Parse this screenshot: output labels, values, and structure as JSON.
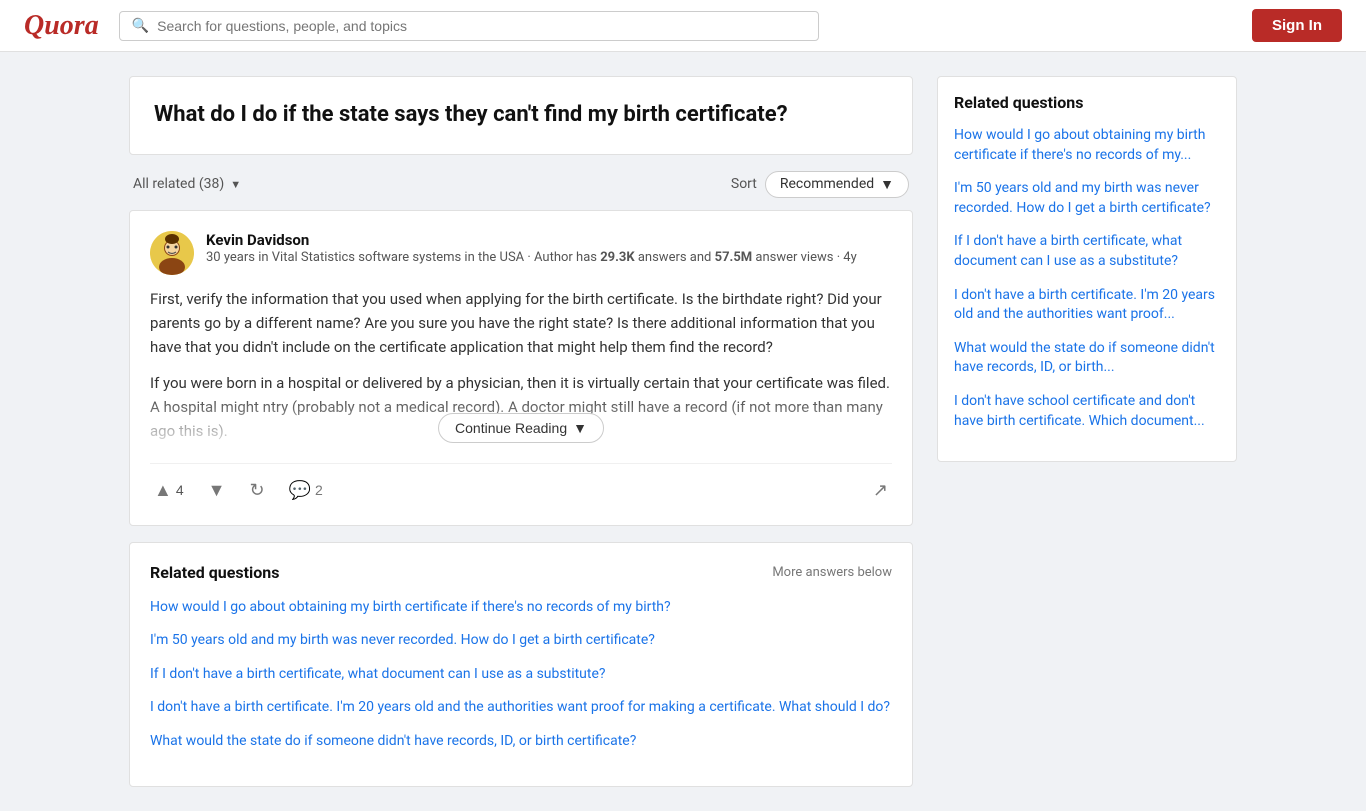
{
  "header": {
    "logo": "Quora",
    "search_placeholder": "Search for questions, people, and topics",
    "sign_in_label": "Sign In"
  },
  "question": {
    "title": "What do I do if the state says they can't find my birth certificate?"
  },
  "filters": {
    "all_related_label": "All related (38)",
    "sort_label": "Sort",
    "recommended_label": "Recommended"
  },
  "answer": {
    "author_name": "Kevin Davidson",
    "author_bio_part1": "30 years in Vital Statistics software systems in the USA · Author has ",
    "answers_count": "29.3K",
    "author_bio_mid": " answers and ",
    "views_count": "57.5M",
    "author_bio_end": " answer views · 4y",
    "text_part1": "First, verify the information that you used when applying for the birth certificate. Is the birthdate right? Did your parents go by a different name? Are you sure you have the right state? Is there additional information that you have that you didn't include on the certificate application that might help them find the record?",
    "text_part2": "If you were born in a hospital or delivered by a physician, then it is virtually certain that your certificate was filed. A hospital might                                  ntry (probably not a medical record). A doctor might still have a record (if not more than many ago this is).",
    "continue_reading": "Continue Reading",
    "upvote_count": "4",
    "comment_count": "2"
  },
  "related_inline": {
    "title": "Related questions",
    "more_answers_label": "More answers below",
    "links": [
      "How would I go about obtaining my birth certificate if there's no records of my birth?",
      "I'm 50 years old and my birth was never recorded. How do I get a birth certificate?",
      "If I don't have a birth certificate, what document can I use as a substitute?",
      "I don't have a birth certificate. I'm 20 years old and the authorities want proof for making a certificate. What should I do?",
      "What would the state do if someone didn't have records, ID, or birth certificate?"
    ]
  },
  "sidebar": {
    "title": "Related questions",
    "links": [
      "How would I go about obtaining my birth certificate if there's no records of my...",
      "I'm 50 years old and my birth was never recorded. How do I get a birth certificate?",
      "If I don't have a birth certificate, what document can I use as a substitute?",
      "I don't have a birth certificate. I'm 20 years old and the authorities want proof...",
      "What would the state do if someone didn't have records, ID, or birth...",
      "I don't have school certificate and don't have birth certificate. Which document..."
    ]
  }
}
